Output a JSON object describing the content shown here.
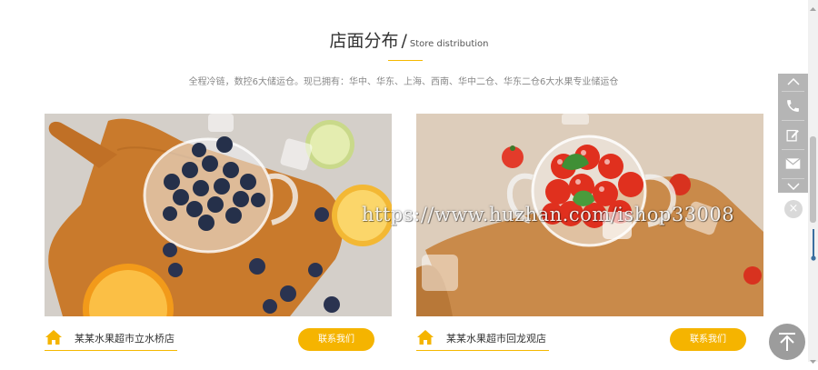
{
  "section": {
    "title_cn": "店面分布",
    "separator": "/",
    "title_en": "Store distribution",
    "subtitle": "全程冷链，数控6大储运仓。现已拥有：华中、华东、上海、西南、华中二仓、华东二仓6大水果专业储运仓"
  },
  "stores": [
    {
      "name": "某某水果超市立水桥店",
      "button": "联系我们",
      "image": "blueberries-in-glass-cup-photo"
    },
    {
      "name": "某某水果超市回龙观店",
      "button": "联系我们",
      "image": "cherry-tomatoes-in-glass-cup-photo"
    }
  ],
  "watermark": {
    "text": "https://www.huzhan.com/ishop33008",
    "close": "×"
  },
  "sidebar": {
    "icons": [
      "chevron-up-icon",
      "phone-icon",
      "edit-icon",
      "mail-icon",
      "chevron-down-icon"
    ]
  },
  "colors": {
    "accent": "#f5b400",
    "sidebar": "#b5b5b5",
    "back_to_top": "#9c9c9c"
  }
}
